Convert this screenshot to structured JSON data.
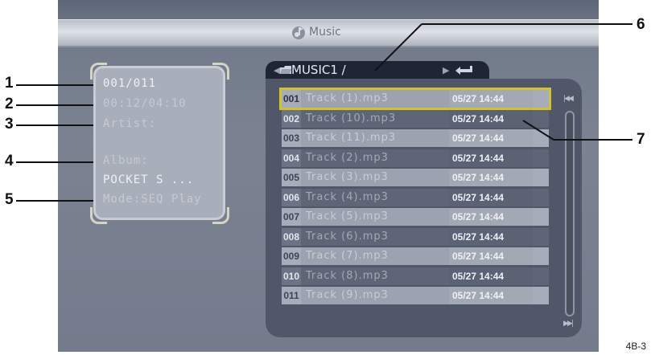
{
  "header": {
    "title": "Music",
    "icon": "music-note-icon"
  },
  "info": {
    "track_index": "001/011",
    "time": "00:12/04:10",
    "artist_label": "Artist:",
    "artist_value": "",
    "album_label": "Album:",
    "album_value": "POCKET S ...",
    "mode": "Mode:SEQ Play"
  },
  "path": {
    "folder": "MUSIC1 /",
    "folder_icon": "folder-icon",
    "return_icon": "return-icon"
  },
  "files": [
    {
      "num": "001",
      "name": "Track (1).mp3",
      "date": "05/27 14:44",
      "selected": true
    },
    {
      "num": "002",
      "name": "Track (10).mp3",
      "date": "05/27 14:44"
    },
    {
      "num": "003",
      "name": "Track (11).mp3",
      "date": "05/27 14:44"
    },
    {
      "num": "004",
      "name": "Track (2).mp3",
      "date": "05/27 14:44"
    },
    {
      "num": "005",
      "name": "Track (3).mp3",
      "date": "05/27 14:44"
    },
    {
      "num": "006",
      "name": "Track (4).mp3",
      "date": "05/27 14:44"
    },
    {
      "num": "007",
      "name": "Track (5).mp3",
      "date": "05/27 14:44"
    },
    {
      "num": "008",
      "name": "Track (6).mp3",
      "date": "05/27 14:44"
    },
    {
      "num": "009",
      "name": "Track (7).mp3",
      "date": "05/27 14:44"
    },
    {
      "num": "010",
      "name": "Track (8).mp3",
      "date": "05/27 14:44"
    },
    {
      "num": "011",
      "name": "Track (9).mp3",
      "date": "05/27 14:44"
    }
  ],
  "scroll": {
    "up_label": "|◀◀",
    "down_label": "▶▶|"
  },
  "callouts": [
    "1",
    "2",
    "3",
    "4",
    "5",
    "6",
    "7"
  ],
  "footer_code": "4B-3",
  "colors": {
    "selection_outline": "#d4c22c",
    "screen_bg": "#7b8393",
    "list_bg": "#4f5768"
  }
}
